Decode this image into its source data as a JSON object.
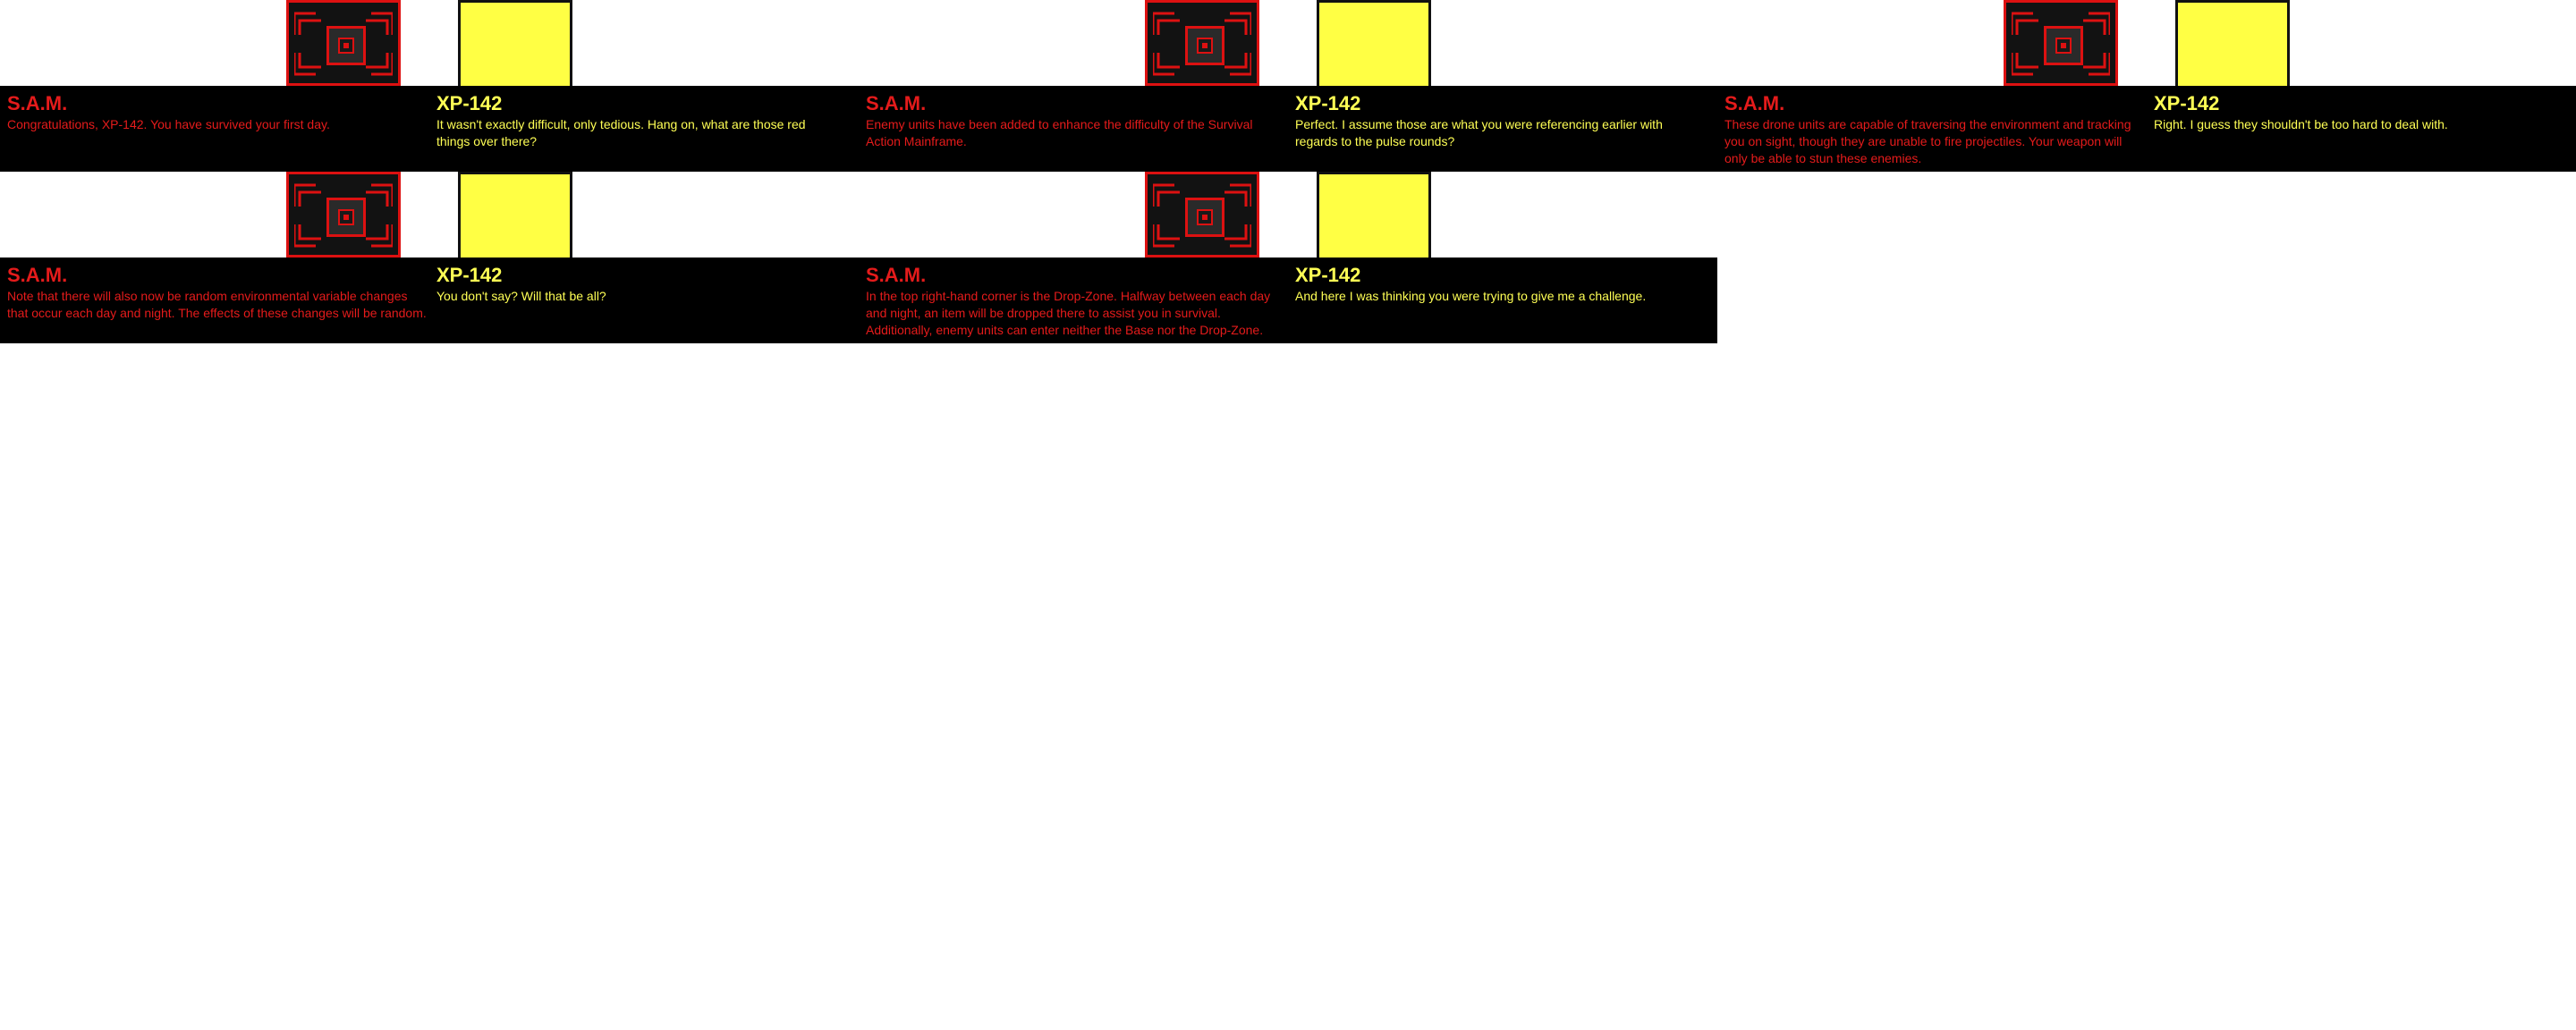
{
  "panels": [
    {
      "sam": {
        "speaker": "S.A.M.",
        "text": "Congratulations, XP-142. You have survived your first day."
      },
      "xp": {
        "speaker": "XP-142",
        "text": "It wasn't exactly difficult, only tedious. Hang on, what are those red things over there?"
      }
    },
    {
      "sam": {
        "speaker": "S.A.M.",
        "text": "Enemy units have been added to enhance the difficulty of the Survival Action Mainframe."
      },
      "xp": {
        "speaker": "XP-142",
        "text": "Perfect. I assume those are what you were referencing earlier with regards to the pulse rounds?"
      }
    },
    {
      "sam": {
        "speaker": "S.A.M.",
        "text": "These drone units are capable of traversing the environment and tracking you on sight, though they are unable to fire projectiles. Your weapon will only be able to stun these enemies."
      },
      "xp": {
        "speaker": "XP-142",
        "text": "Right. I guess they shouldn't be too hard to deal with."
      }
    },
    {
      "sam": {
        "speaker": "S.A.M.",
        "text": "Note that there will also now be random environmental variable changes that occur each day and night. The effects of these changes will be random."
      },
      "xp": {
        "speaker": "XP-142",
        "text": "You don't say? Will that be all?"
      }
    },
    {
      "sam": {
        "speaker": "S.A.M.",
        "text": "In the top right-hand corner is the Drop-Zone. Halfway between each day and night, an item will be dropped there to assist you in survival. Additionally, enemy units can enter neither the Base nor the Drop-Zone."
      },
      "xp": {
        "speaker": "XP-142",
        "text": "And here I was thinking you were trying to give me a challenge."
      }
    }
  ],
  "colors": {
    "sam": "#e51b1b",
    "xp": "#ffff55",
    "dialog_bg": "#000000",
    "portrait_xp": "#ffff44"
  },
  "icons": {
    "sam_portrait": "sam-robot-portrait-icon",
    "xp_portrait": "xp-142-portrait-icon"
  }
}
